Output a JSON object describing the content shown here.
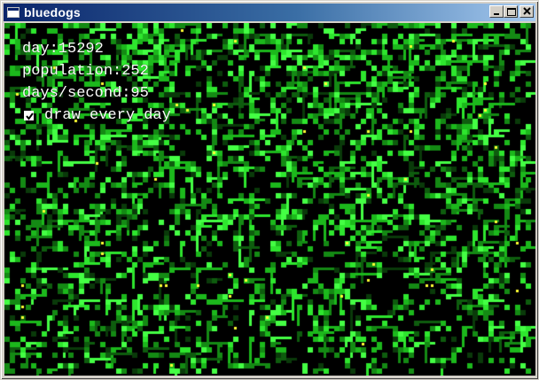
{
  "window": {
    "title": "bluedogs",
    "icon": "window-app-icon"
  },
  "caption_buttons": {
    "minimize": "minimize-icon",
    "maximize": "maximize-icon",
    "close": "close-icon"
  },
  "stats": {
    "day": "day:15292",
    "population": "population:252",
    "days_per_second": "days/second:95"
  },
  "options": {
    "draw_every_day_label": "draw every day",
    "draw_every_day_checked": true
  },
  "colors": {
    "background": "#000000",
    "cell_bright": "#33ff33",
    "cell_mid": "#1fbf1f",
    "cell_dark": "#0b5a0b",
    "dog": "#ffff33"
  }
}
